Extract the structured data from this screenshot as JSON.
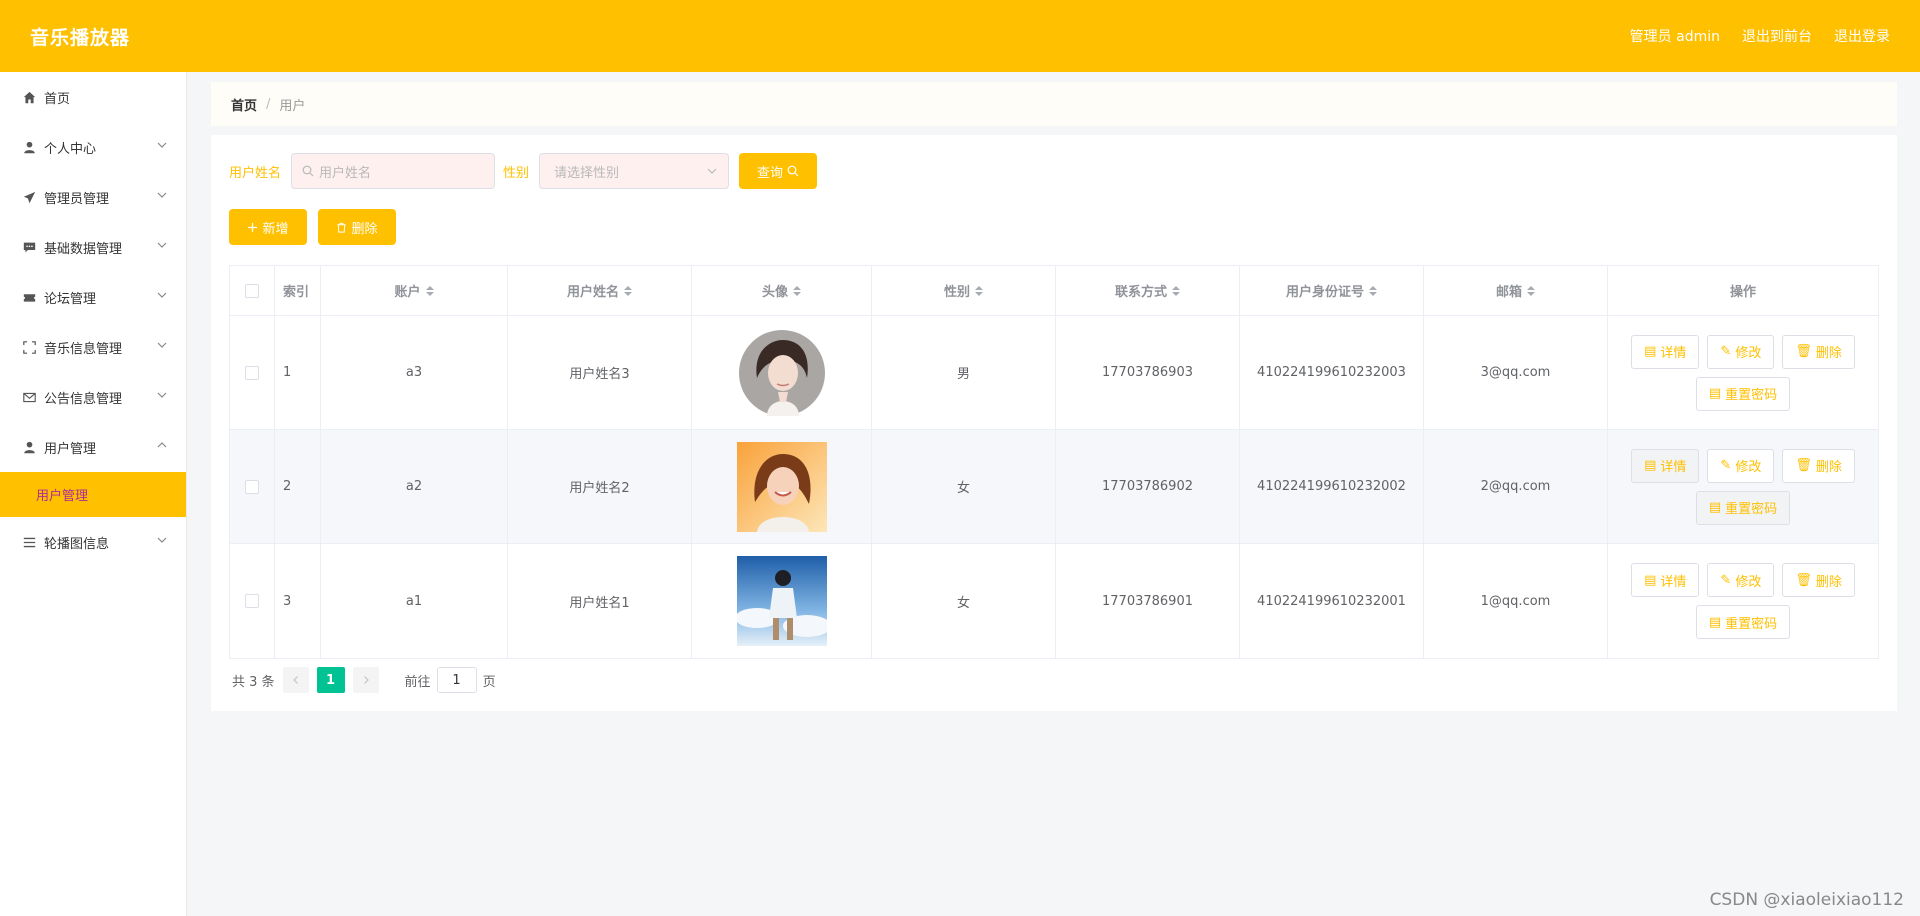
{
  "header": {
    "brand": "音乐播放器",
    "nav": [
      "管理员 admin",
      "退出到前台",
      "退出登录"
    ]
  },
  "sidebar": {
    "items": [
      {
        "label": "首页",
        "icon": "home-icon",
        "expandable": false
      },
      {
        "label": "个人中心",
        "icon": "user-icon",
        "expandable": true
      },
      {
        "label": "管理员管理",
        "icon": "send-icon",
        "expandable": true
      },
      {
        "label": "基础数据管理",
        "icon": "chat-icon",
        "expandable": true
      },
      {
        "label": "论坛管理",
        "icon": "ticket-icon",
        "expandable": true
      },
      {
        "label": "音乐信息管理",
        "icon": "fullscreen-icon",
        "expandable": true
      },
      {
        "label": "公告信息管理",
        "icon": "mail-icon",
        "expandable": true
      },
      {
        "label": "用户管理",
        "icon": "user-icon",
        "expandable": true,
        "open": true
      },
      {
        "label": "轮播图信息",
        "icon": "list-icon",
        "expandable": true
      }
    ],
    "active_sub": "用户管理"
  },
  "breadcrumb": {
    "home": "首页",
    "separator": "/",
    "current": "用户"
  },
  "search": {
    "name_label": "用户姓名",
    "name_placeholder": "用户姓名",
    "gender_label": "性别",
    "gender_placeholder": "请选择性别",
    "query_label": "查询"
  },
  "actions": {
    "add_label": "新增",
    "delete_label": "删除"
  },
  "table": {
    "headers": [
      "索引",
      "账户",
      "用户姓名",
      "头像",
      "性别",
      "联系方式",
      "用户身份证号",
      "邮箱",
      "操作"
    ],
    "rows": [
      {
        "index": "1",
        "account": "a3",
        "name": "用户姓名3",
        "gender": "男",
        "phone": "17703786903",
        "id_card": "410224199610232003",
        "email": "3@qq.com"
      },
      {
        "index": "2",
        "account": "a2",
        "name": "用户姓名2",
        "gender": "女",
        "phone": "17703786902",
        "id_card": "410224199610232002",
        "email": "2@qq.com"
      },
      {
        "index": "3",
        "account": "a1",
        "name": "用户姓名1",
        "gender": "女",
        "phone": "17703786901",
        "id_card": "410224199610232001",
        "email": "1@qq.com"
      }
    ],
    "row_actions": {
      "detail": "详情",
      "edit": "修改",
      "delete": "删除",
      "reset": "重置密码"
    }
  },
  "pagination": {
    "total": "共 3 条",
    "current_page": "1",
    "goto_label": "前往",
    "goto_value": "1",
    "page_suffix": "页"
  },
  "watermark": "CSDN @xiaoleixiao112",
  "colors": {
    "accent": "#ffc000",
    "page_active": "#00c292",
    "submenu_text": "#b02a9a"
  }
}
